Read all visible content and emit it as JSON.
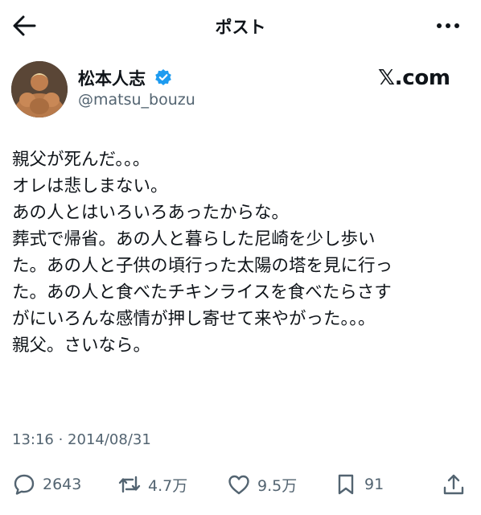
{
  "header": {
    "title": "ポスト"
  },
  "author": {
    "name": "松本人志",
    "handle": "@matsu_bouzu",
    "verified_color": "#1d9bf0"
  },
  "source_label": "𝕏.com",
  "tweet": {
    "lines": [
      "親父が死んだ。。。",
      "オレは悲しまない。",
      "あの人とはいろいろあったからな。",
      "葬式で帰省。あの人と暮らした尼崎を少し歩い",
      "た。あの人と子供の頃行った太陽の塔を見に行っ",
      "た。あの人と食べたチキンライスを食べたらさす",
      "がにいろんな感情が押し寄せて来やがった。。。",
      "親父。さいなら。"
    ]
  },
  "timestamp": "13:16 · 2014/08/31",
  "actions": {
    "replies": "2643",
    "reposts": "4.7万",
    "likes": "9.5万",
    "bookmarks": "91"
  }
}
